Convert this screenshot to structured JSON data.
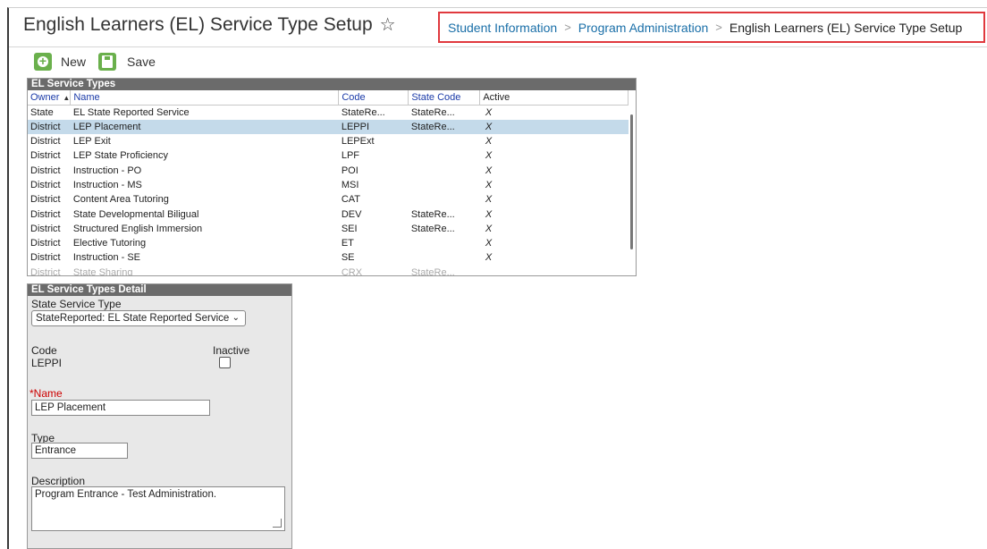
{
  "page": {
    "title": "English Learners (EL) Service Type Setup",
    "favorite_icon": "star-outline-icon"
  },
  "breadcrumb": {
    "items": [
      "Student Information",
      "Program Administration",
      "English Learners (EL) Service Type Setup"
    ]
  },
  "toolbar": {
    "new_label": "New",
    "save_label": "Save",
    "accent": "#6ab04c"
  },
  "grid": {
    "title": "EL Service Types",
    "columns": [
      "Owner",
      "Name",
      "Code",
      "State Code",
      "Active"
    ],
    "sort_column": "Owner",
    "rows": [
      {
        "owner": "State",
        "name": "EL State Reported Service",
        "code": "StateRe...",
        "state_code": "StateRe...",
        "active": "X"
      },
      {
        "owner": "District",
        "name": "LEP Placement",
        "code": "LEPPI",
        "state_code": "StateRe...",
        "active": "X"
      },
      {
        "owner": "District",
        "name": "LEP Exit",
        "code": "LEPExt",
        "state_code": "",
        "active": "X"
      },
      {
        "owner": "District",
        "name": "LEP State Proficiency",
        "code": "LPF",
        "state_code": "",
        "active": "X"
      },
      {
        "owner": "District",
        "name": "Instruction - PO",
        "code": "POI",
        "state_code": "",
        "active": "X"
      },
      {
        "owner": "District",
        "name": "Instruction - MS",
        "code": "MSI",
        "state_code": "",
        "active": "X"
      },
      {
        "owner": "District",
        "name": "Content Area Tutoring",
        "code": "CAT",
        "state_code": "",
        "active": "X"
      },
      {
        "owner": "District",
        "name": "State Developmental Biligual",
        "code": "DEV",
        "state_code": "StateRe...",
        "active": "X"
      },
      {
        "owner": "District",
        "name": "Structured English Immersion",
        "code": "SEI",
        "state_code": "StateRe...",
        "active": "X"
      },
      {
        "owner": "District",
        "name": "Elective Tutoring",
        "code": "ET",
        "state_code": "",
        "active": "X"
      },
      {
        "owner": "District",
        "name": "Instruction - SE",
        "code": "SE",
        "state_code": "",
        "active": "X"
      },
      {
        "owner": "District",
        "name": "State Sharing",
        "code": "CRX",
        "state_code": "StateRe...",
        "active": ""
      }
    ],
    "selected_row_color": "#c4daea"
  },
  "detail": {
    "title": "EL Service Types Detail",
    "state_service_type_label": "State Service Type",
    "state_service_type_value": "StateReported: EL State Reported Service",
    "code_label": "Code",
    "code_value": "LEPPI",
    "inactive_label": "Inactive",
    "name_required_mark": "*",
    "name_label": "Name",
    "name_value": "LEP Placement",
    "type_label": "Type",
    "type_value": "Entrance",
    "description_label": "Description",
    "description_value": "Program Entrance - Test Administration."
  }
}
